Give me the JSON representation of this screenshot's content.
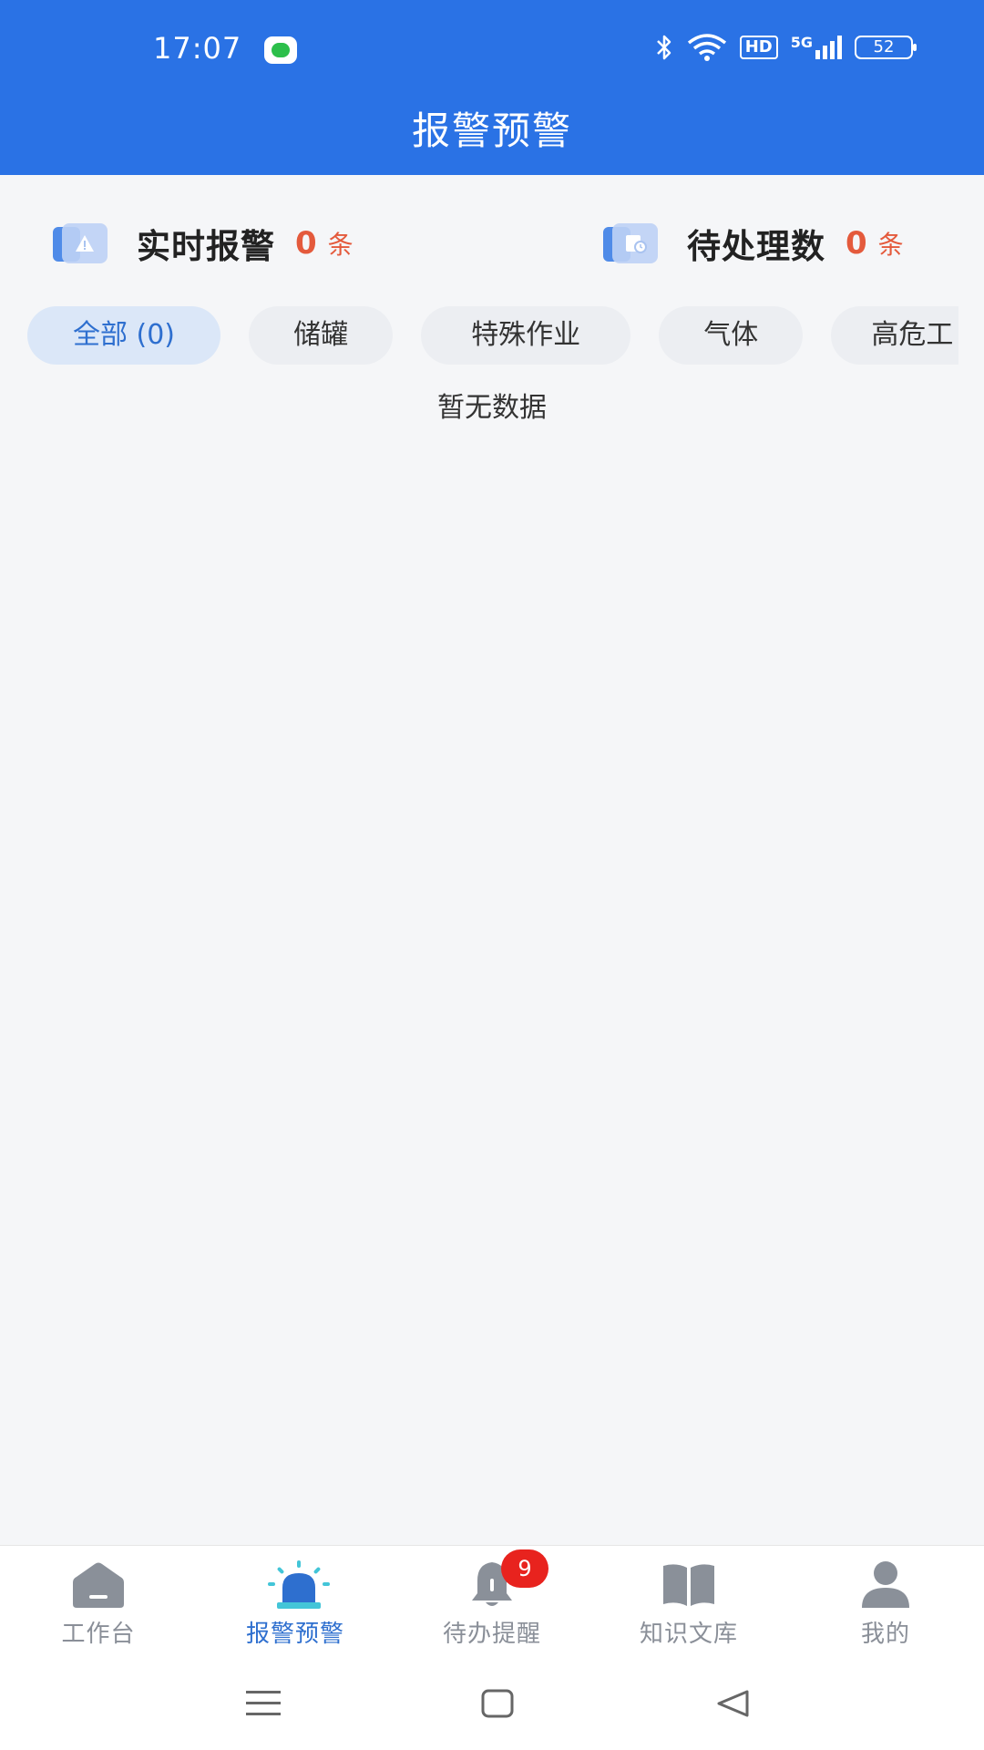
{
  "status_bar": {
    "time": "17:07",
    "hd_label": "HD",
    "network_label": "5G",
    "battery": "52"
  },
  "header": {
    "title": "报警预警"
  },
  "summary": {
    "realtime": {
      "label": "实时报警",
      "count": "0",
      "unit": "条"
    },
    "pending": {
      "label": "待处理数",
      "count": "0",
      "unit": "条"
    }
  },
  "filters": {
    "chips": [
      {
        "label": "全部 (0)",
        "active": true
      },
      {
        "label": "储罐",
        "active": false
      },
      {
        "label": "特殊作业",
        "active": false
      },
      {
        "label": "气体",
        "active": false
      },
      {
        "label": "高危工",
        "active": false
      }
    ]
  },
  "empty_state": "暂无数据",
  "tabbar": {
    "items": [
      {
        "label": "工作台",
        "icon": "home-icon"
      },
      {
        "label": "报警预警",
        "icon": "alarm-light-icon",
        "active": true
      },
      {
        "label": "待办提醒",
        "icon": "bell-icon",
        "badge": "9"
      },
      {
        "label": "知识文库",
        "icon": "book-icon"
      },
      {
        "label": "我的",
        "icon": "user-icon"
      }
    ]
  },
  "colors": {
    "header_bg": "#2a72e5",
    "accent": "#2e6fcf",
    "count": "#e45a3c",
    "badge": "#e8231e"
  }
}
